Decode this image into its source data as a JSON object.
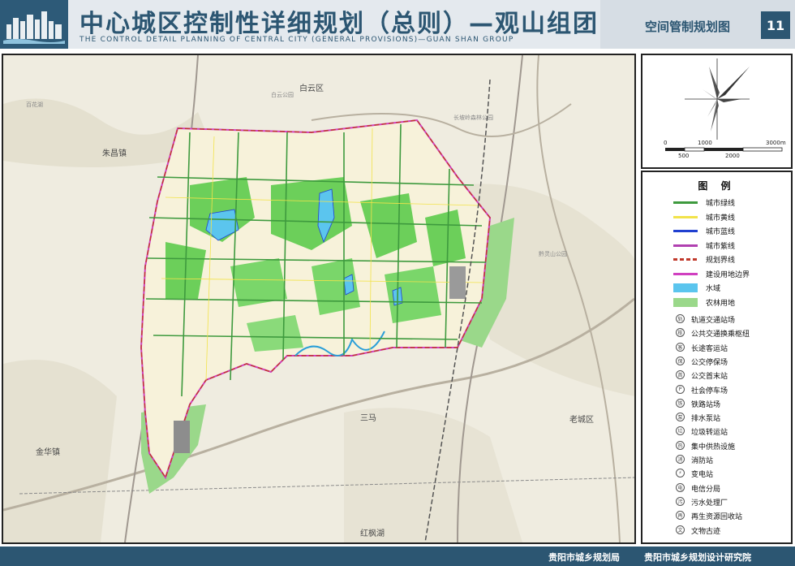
{
  "header": {
    "title_cn": "中心城区控制性详细规划（总则）—观山组团",
    "title_en": "THE CONTROL DETAIL PLANNING OF CENTRAL CITY (GENERAL PROVISIONS)—GUAN SHAN GROUP",
    "sheet_title": "空间管制规划图",
    "page_number": "11"
  },
  "map": {
    "places": [
      {
        "id": "baiyun",
        "label": "白云区"
      },
      {
        "id": "zhuchang",
        "label": "朱昌镇"
      },
      {
        "id": "sanma",
        "label": "三马"
      },
      {
        "id": "laocheng",
        "label": "老城区"
      },
      {
        "id": "jinhua",
        "label": "金华镇"
      },
      {
        "id": "hongshui",
        "label": "红枫湖"
      }
    ],
    "parks": [
      {
        "id": "baihua",
        "label": "百花湖"
      },
      {
        "id": "changpo",
        "label": "长坡岭森林公园"
      },
      {
        "id": "qianling",
        "label": "黔灵山公园"
      },
      {
        "id": "baiyunhu",
        "label": "白云公园"
      }
    ]
  },
  "compass": {
    "scale_top": [
      "0",
      "1000",
      "3000m"
    ],
    "scale_bottom": [
      "500",
      "2000"
    ]
  },
  "legend": {
    "title": "图 例",
    "lines": [
      {
        "label": "城市绿线",
        "color": "#3e9a3e",
        "style": "line"
      },
      {
        "label": "城市黄线",
        "color": "#f2e34a",
        "style": "line"
      },
      {
        "label": "城市蓝线",
        "color": "#2040d0",
        "style": "line"
      },
      {
        "label": "城市紫线",
        "color": "#b040b0",
        "style": "line"
      },
      {
        "label": "规划界线",
        "color": "#c0392b",
        "style": "dash"
      },
      {
        "label": "建设用地边界",
        "color": "#d040c0",
        "style": "line"
      },
      {
        "label": "水域",
        "color": "#5bc5ee",
        "style": "fill"
      },
      {
        "label": "农林用地",
        "color": "#9ad88a",
        "style": "fill"
      }
    ],
    "symbols": [
      {
        "label": "轨道交通站场",
        "glyph": "轨"
      },
      {
        "label": "公共交通换乘枢纽",
        "glyph": "枢"
      },
      {
        "label": "长途客运站",
        "glyph": "客"
      },
      {
        "label": "公交停保场",
        "glyph": "保"
      },
      {
        "label": "公交首末站",
        "glyph": "首"
      },
      {
        "label": "社会停车场",
        "glyph": "P"
      },
      {
        "label": "铁路站场",
        "glyph": "铁"
      },
      {
        "label": "排水泵站",
        "glyph": "泵"
      },
      {
        "label": "垃圾转运站",
        "glyph": "垃"
      },
      {
        "label": "集中供热设施",
        "glyph": "热"
      },
      {
        "label": "消防站",
        "glyph": "消"
      },
      {
        "label": "变电站",
        "glyph": "⚡"
      },
      {
        "label": "电信分局",
        "glyph": "电"
      },
      {
        "label": "污水处理厂",
        "glyph": "污"
      },
      {
        "label": "再生资源回收站",
        "glyph": "再"
      },
      {
        "label": "文物古迹",
        "glyph": "文"
      }
    ]
  },
  "footer": {
    "org1": "贵阳市城乡规划局",
    "org2": "贵阳市城乡规划设计研究院"
  }
}
